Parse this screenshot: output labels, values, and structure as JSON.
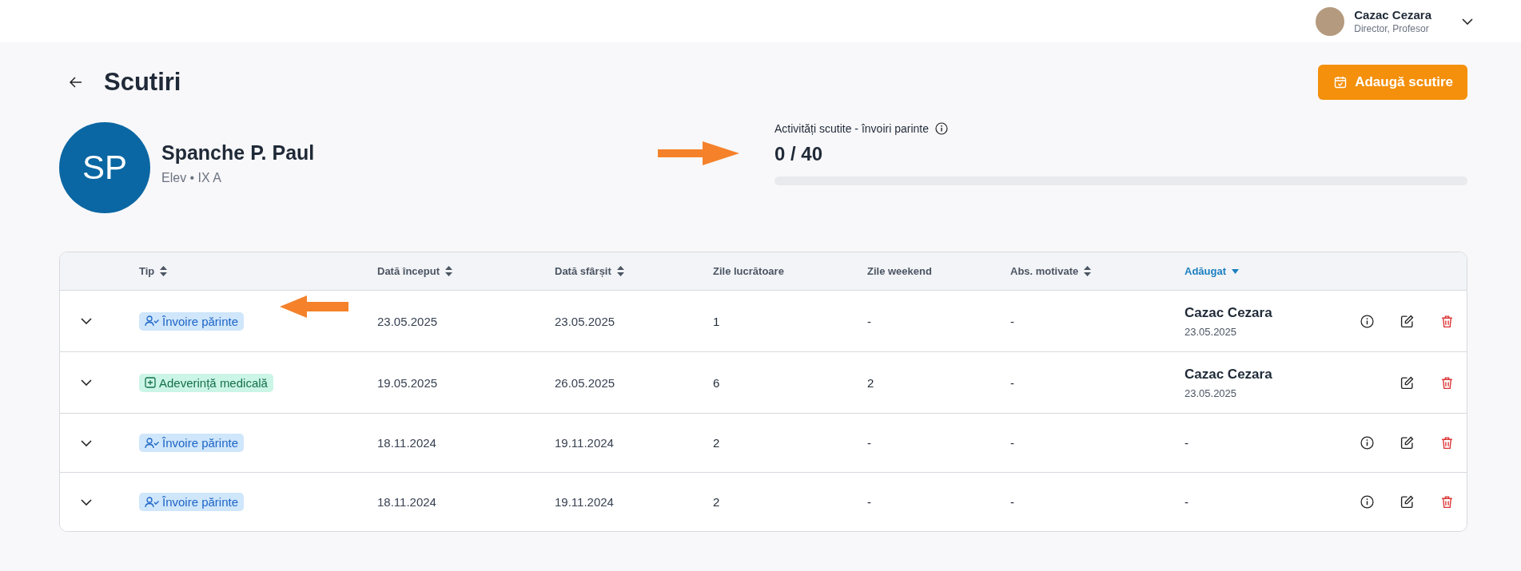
{
  "user": {
    "name": "Cazac Cezara",
    "role": "Director, Profesor"
  },
  "page": {
    "title": "Scutiri",
    "add_button": "Adaugă scutire"
  },
  "student": {
    "initials": "SP",
    "name": "Spanche P. Paul",
    "subtitle": "Elev • IX A"
  },
  "quota": {
    "label": "Activități scutite - învoiri parinte",
    "reading": "0 / 40",
    "level": 0
  },
  "annotations": [
    {
      "kind": "arrow-right"
    },
    {
      "kind": "arrow-left"
    }
  ],
  "table": {
    "columns": [
      {
        "label": "Tip",
        "sortable": true,
        "selected": false
      },
      {
        "label": "Dată început",
        "sortable": true,
        "selected": false
      },
      {
        "label": "Dată sfârșit",
        "sortable": true,
        "selected": false
      },
      {
        "label": "Zile lucrătoare",
        "sortable": false,
        "selected": false
      },
      {
        "label": "Zile weekend",
        "sortable": false,
        "selected": false
      },
      {
        "label": "Abs. motivate",
        "sortable": true,
        "selected": false
      },
      {
        "label": "Adăugat",
        "sortable": true,
        "selected": true
      }
    ],
    "rows": [
      {
        "type": {
          "kind": "parent",
          "label": "Învoire părinte"
        },
        "start": "23.05.2025",
        "end": "23.05.2025",
        "workdays": "1",
        "weekend": "-",
        "excused": "-",
        "added": {
          "name": "Cazac Cezara",
          "date": "23.05.2025"
        },
        "has_info": true
      },
      {
        "type": {
          "kind": "medical",
          "label": "Adeverință medicală"
        },
        "start": "19.05.2025",
        "end": "26.05.2025",
        "workdays": "6",
        "weekend": "2",
        "excused": "-",
        "added": {
          "name": "Cazac Cezara",
          "date": "23.05.2025"
        },
        "has_info": false
      },
      {
        "type": {
          "kind": "parent",
          "label": "Învoire părinte"
        },
        "start": "18.11.2024",
        "end": "19.11.2024",
        "workdays": "2",
        "weekend": "-",
        "excused": "-",
        "added": {
          "name": "-"
        },
        "has_info": true
      },
      {
        "type": {
          "kind": "parent",
          "label": "Învoire părinte"
        },
        "start": "18.11.2024",
        "end": "19.11.2024",
        "workdays": "2",
        "weekend": "-",
        "excused": "-",
        "added": {
          "name": "-"
        },
        "has_info": true
      }
    ]
  }
}
